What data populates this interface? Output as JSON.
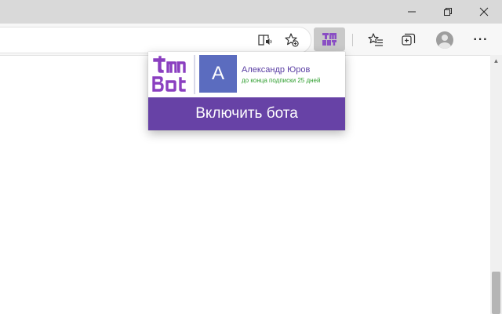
{
  "window": {
    "controls": [
      "minimize-icon",
      "maximize-icon",
      "close-icon"
    ]
  },
  "toolbar": {
    "icons": [
      "immersive-reader-icon",
      "add-favorite-icon",
      "tm-bot-extension-icon",
      "favorites-icon",
      "collections-icon",
      "profile-icon",
      "more-icon"
    ],
    "more_label": "···"
  },
  "popup": {
    "logo_name": "tm-bot-logo",
    "user": {
      "initial": "A",
      "name": "Александр Юров",
      "subscription": "до конца подписки 25 дней"
    },
    "button_label": "Включить бота",
    "colors": {
      "brand": "#6742a6",
      "avatar": "#5b6cbf",
      "name_text": "#5a3ea3",
      "subscription_text": "#2f9e2f"
    }
  }
}
